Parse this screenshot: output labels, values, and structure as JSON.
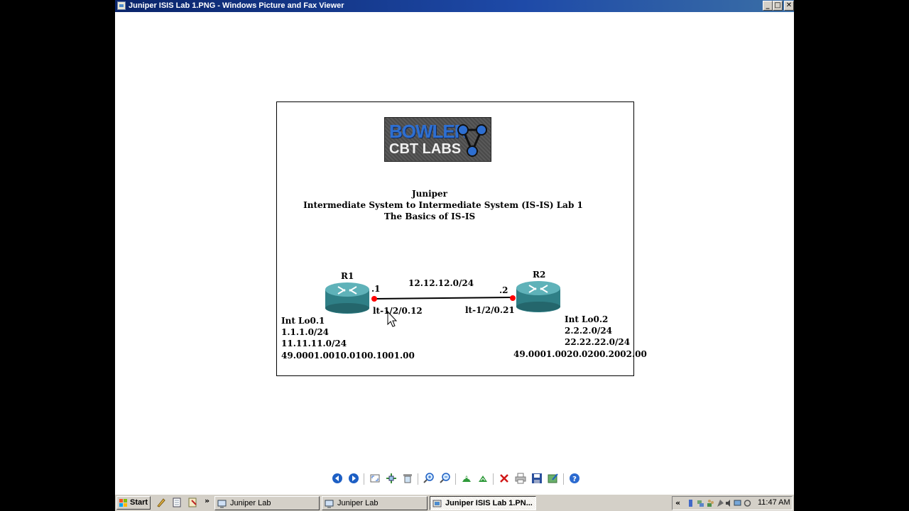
{
  "window": {
    "title": "Juniper ISIS Lab 1.PNG - Windows Picture and Fax Viewer",
    "controls": {
      "minimize": "_",
      "maximize": "□",
      "close": "✕"
    }
  },
  "image": {
    "logo": {
      "line1": "BOWLER",
      "line2": "CBT LABS"
    },
    "title_lines": [
      "Juniper",
      "Intermediate System to Intermediate System (IS-IS) Lab 1",
      "The Basics of IS-IS"
    ],
    "diagram": {
      "link_subnet": "12.12.12.0/24",
      "r1": {
        "name": "R1",
        "host_id": ".1",
        "interface": "lt-1/2/0.12",
        "loopback_label": "Int Lo0.1",
        "addresses": [
          "1.1.1.0/24",
          "11.11.11.0/24"
        ],
        "net": "49.0001.0010.0100.1001.00"
      },
      "r2": {
        "name": "R2",
        "host_id": ".2",
        "interface": "lt-1/2/0.21",
        "loopback_label": "Int Lo0.2",
        "addresses": [
          "2.2.2.0/24",
          "22.22.22.0/24"
        ],
        "net": "49.0001.0020.0200.2002.00"
      }
    }
  },
  "viewer_toolbar": {
    "icons": [
      "previous-image-icon",
      "next-image-icon",
      "best-fit-icon",
      "actual-size-icon",
      "slideshow-icon",
      "zoom-in-icon",
      "zoom-out-icon",
      "rotate-clockwise-icon",
      "rotate-counterclockwise-icon",
      "delete-icon",
      "print-icon",
      "save-icon",
      "edit-icon",
      "help-icon"
    ]
  },
  "taskbar": {
    "start_label": "Start",
    "overflow": "»",
    "tasks": [
      {
        "label": "Juniper Lab",
        "active": false
      },
      {
        "label": "Juniper Lab",
        "active": false
      },
      {
        "label": "Juniper ISIS Lab 1.PN...",
        "active": true
      }
    ],
    "tray_overflow": "«",
    "clock": "11:47 AM"
  },
  "colors": {
    "titlebar": "#0a246a",
    "link_dot": "#ff0000",
    "router": "#2f7f86"
  }
}
